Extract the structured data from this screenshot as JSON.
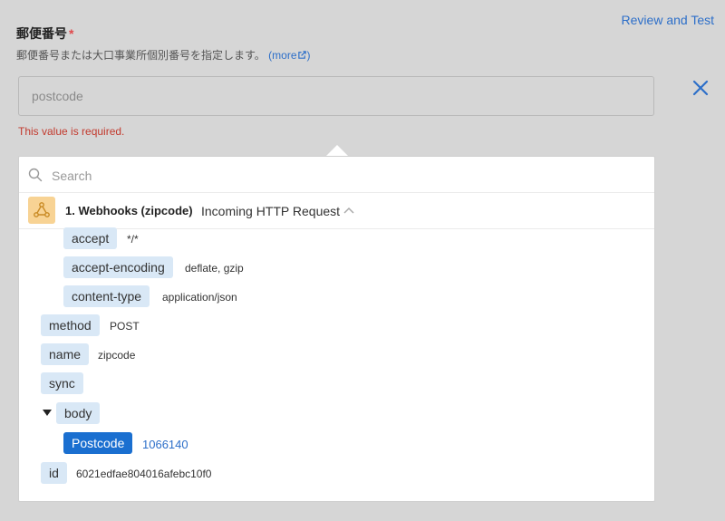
{
  "field": {
    "label": "郵便番号",
    "required_mark": "*",
    "description": "郵便番号または大口事業所個別番号を指定します。",
    "more_label": "(more",
    "more_suffix": ")",
    "placeholder": "postcode",
    "error": "This value is required."
  },
  "header": {
    "review_test": "Review and Test"
  },
  "icons": {
    "close": "close-icon",
    "search": "search-icon",
    "webhook": "webhook-icon",
    "chevron": "chevron-up-icon",
    "external": "external-link-icon"
  },
  "colors": {
    "accent": "#1a6fd0",
    "link": "#2d6fc9",
    "error": "#c23a2e",
    "key_bg": "#d9e8f6",
    "webhook_bg": "#f8d394"
  },
  "picker": {
    "search_placeholder": "Search",
    "trigger": {
      "name": "1. Webhooks (zipcode)",
      "type": "Incoming HTTP Request"
    },
    "headers": [
      {
        "key": "accept",
        "value": "*/*"
      },
      {
        "key": "accept-encoding",
        "value": "deflate, gzip"
      },
      {
        "key": "content-type",
        "value": "application/json"
      }
    ],
    "fields": {
      "method": {
        "key": "method",
        "value": "POST"
      },
      "name": {
        "key": "name",
        "value": "zipcode"
      },
      "sync": {
        "key": "sync"
      },
      "body": {
        "key": "body"
      },
      "postcode": {
        "key": "Postcode",
        "value": "1066140"
      },
      "id": {
        "key": "id",
        "value": "6021edfae804016afebc10f0"
      }
    }
  }
}
